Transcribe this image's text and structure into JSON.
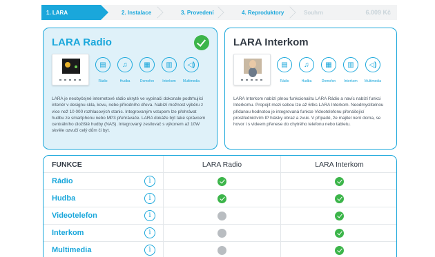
{
  "steps": {
    "items": [
      {
        "label": "1. LARA"
      },
      {
        "label": "2. Instalace"
      },
      {
        "label": "3. Provedení"
      },
      {
        "label": "4. Reproduktory"
      },
      {
        "label": "Souhrn"
      }
    ],
    "price": "6.009 Kč"
  },
  "products": {
    "radio": {
      "title": "LARA Radio",
      "features": [
        "Rádio",
        "Hudba",
        "Domofon",
        "Interkom",
        "Multimedia"
      ],
      "description": "LARA je neobyčejné internetové rádio ukryté ve vypínači dokonale podtrhující interiér v designu skla, kovu, nebo přírodního dřeva. Nabízí možnost výběru z více než 10 000 rozhlasových stanic. Integrovaným vstupem lze přehrávat hudbu ze smartphonu nebo MP3 přehrávače. LARA dokáže být také správcem centrálního úložiště hudby (NAS). Integrovaný zesilovač s výkonem až 10W skvěle ozvučí celý dům či byt."
    },
    "interkom": {
      "title": "LARA Interkom",
      "features": [
        "Rádio",
        "Hudba",
        "Domofon",
        "Interkom",
        "Multimedia"
      ],
      "description": "LARA Interkom nabízí plnou funkcionalitu LARA Rádio a navíc nabízí funkci Interkomu. Propojit mezi sebou lze až 64ks LARA Interkom. Neodmyslitelnou přidanou hodnotou je integrovaná funkce Videotelefonu přenášející prostřednictvím IP hlásky obraz a zvuk. V případě, že majitel není doma, se hovor i s videem přenese do chytrého telefonu nebo tabletu."
    }
  },
  "table": {
    "headers": {
      "features": "FUNKCE",
      "radio": "LARA Radio",
      "interkom": "LARA Interkom"
    },
    "info_symbol": "i",
    "rows": [
      {
        "name": "Rádio",
        "radio": true,
        "interkom": true
      },
      {
        "name": "Hudba",
        "radio": true,
        "interkom": true
      },
      {
        "name": "Videotelefon",
        "radio": false,
        "interkom": true
      },
      {
        "name": "Interkom",
        "radio": false,
        "interkom": true
      },
      {
        "name": "Multimedia",
        "radio": false,
        "interkom": true
      }
    ]
  },
  "colors": {
    "accent": "#1aa7db",
    "check": "#3cb54a",
    "unavailable": "#b9bdc1"
  }
}
